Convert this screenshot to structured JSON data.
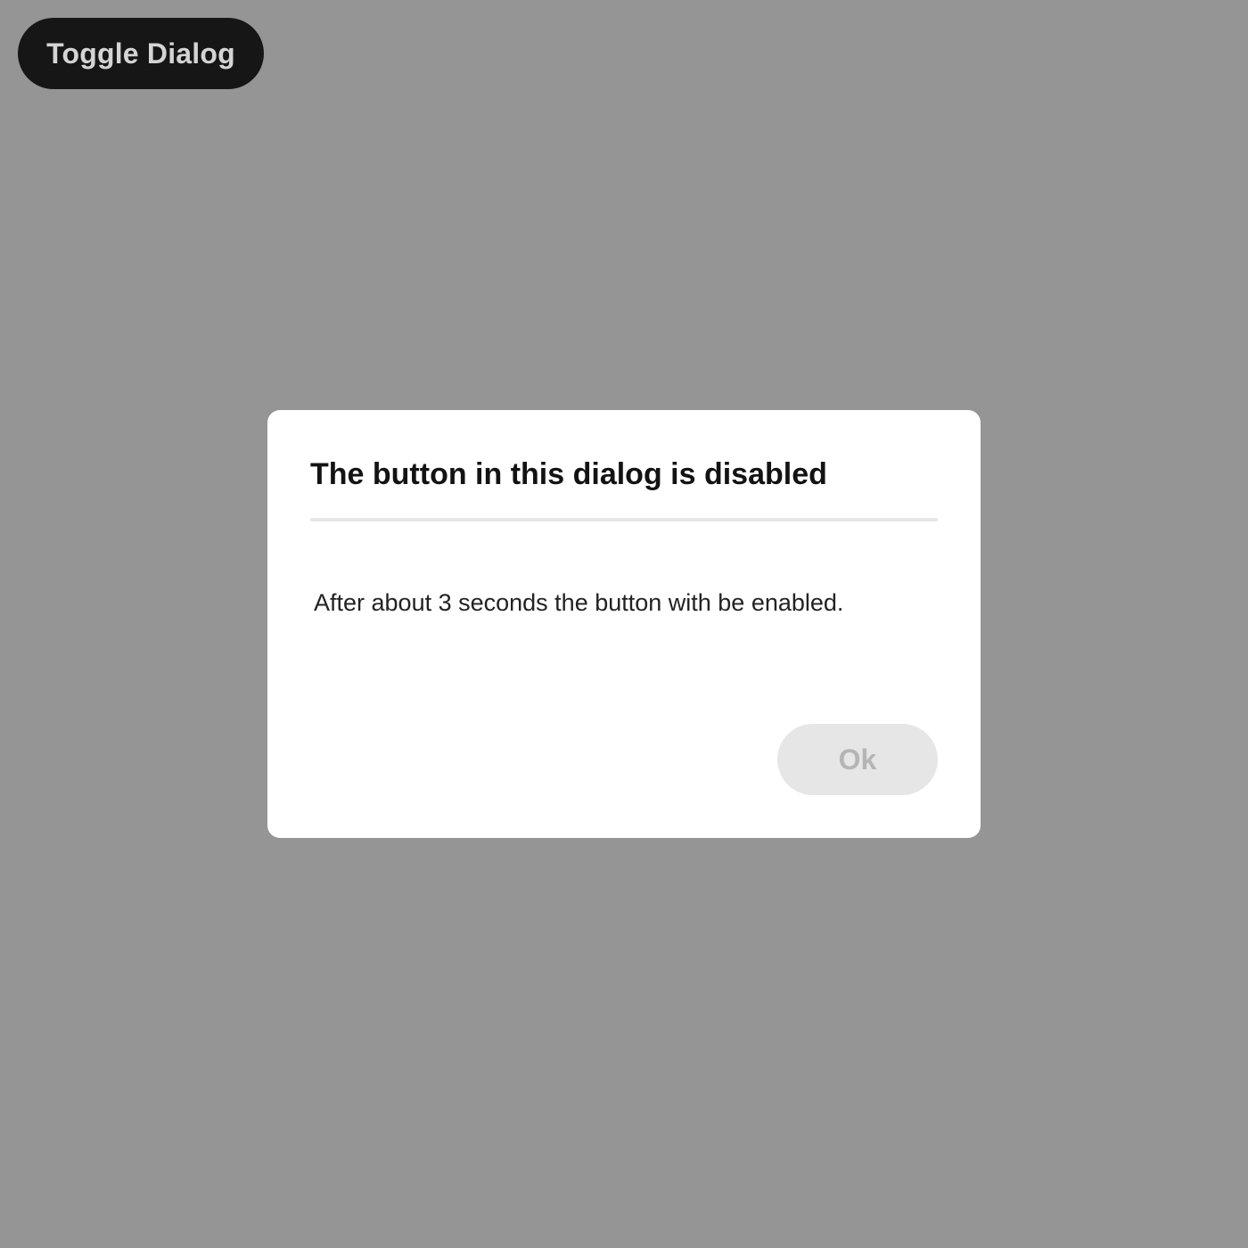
{
  "toggle_button": {
    "label": "Toggle Dialog"
  },
  "dialog": {
    "title": "The button in this dialog is disabled",
    "body": "After about 3 seconds the button with be enabled.",
    "ok_button": {
      "label": "Ok",
      "disabled": true
    }
  },
  "colors": {
    "backdrop": "#959595",
    "toggle_button_bg": "#161616",
    "toggle_button_text": "#d4d4d4",
    "dialog_bg": "#ffffff",
    "divider": "#e6e6e6",
    "disabled_button_bg": "#e6e6e6",
    "disabled_button_text": "#b5b5b5"
  }
}
